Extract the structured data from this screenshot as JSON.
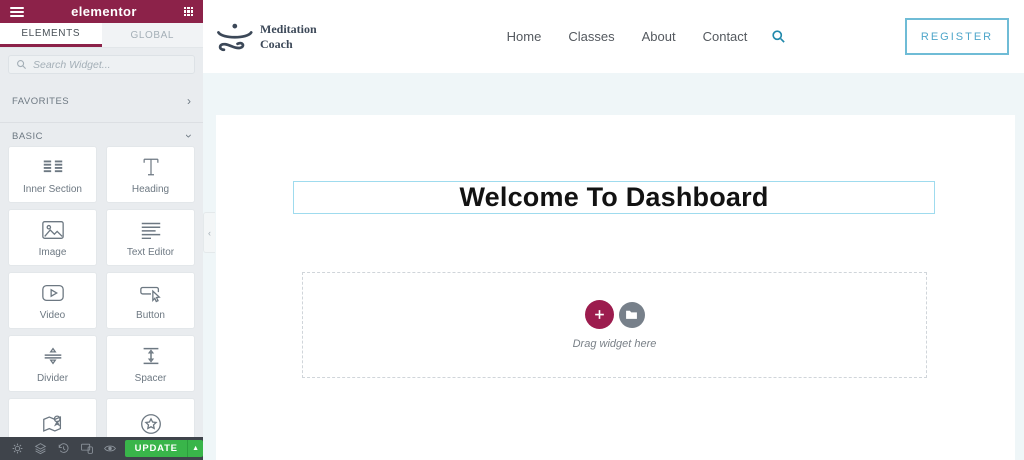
{
  "panel": {
    "brand": "elementor",
    "tabs": [
      {
        "label": "ELEMENTS"
      },
      {
        "label": "GLOBAL"
      }
    ],
    "search_placeholder": "Search Widget...",
    "sections": [
      {
        "label": "FAVORITES"
      },
      {
        "label": "BASIC"
      }
    ],
    "widgets": [
      {
        "label": "Inner Section",
        "icon": "inner-section-icon"
      },
      {
        "label": "Heading",
        "icon": "heading-icon"
      },
      {
        "label": "Image",
        "icon": "image-icon"
      },
      {
        "label": "Text Editor",
        "icon": "text-editor-icon"
      },
      {
        "label": "Video",
        "icon": "video-icon"
      },
      {
        "label": "Button",
        "icon": "button-icon"
      },
      {
        "label": "Divider",
        "icon": "divider-icon"
      },
      {
        "label": "Spacer",
        "icon": "spacer-icon"
      },
      {
        "label": "",
        "icon": "map-icon"
      },
      {
        "label": "",
        "icon": "star-icon"
      }
    ],
    "footer": {
      "update_label": "UPDATE",
      "arrow": "▲"
    }
  },
  "site": {
    "logo": {
      "line1": "Meditation",
      "line2": "Coach"
    },
    "nav": [
      {
        "label": "Home"
      },
      {
        "label": "Classes"
      },
      {
        "label": "About"
      },
      {
        "label": "Contact"
      }
    ],
    "register_label": "REGISTER"
  },
  "canvas": {
    "heading": "Welcome To Dashboard",
    "drag_hint": "Drag widget here",
    "add_symbol": "+"
  },
  "glyphs": {
    "chevron_right": "›",
    "chevron_down": "›"
  },
  "colors": {
    "panel_accent": "#8c2249",
    "update_green": "#39b54a",
    "register_blue": "#4fa6ca",
    "add_button": "#9c1c4e",
    "preview_bg": "#eff6f8"
  }
}
